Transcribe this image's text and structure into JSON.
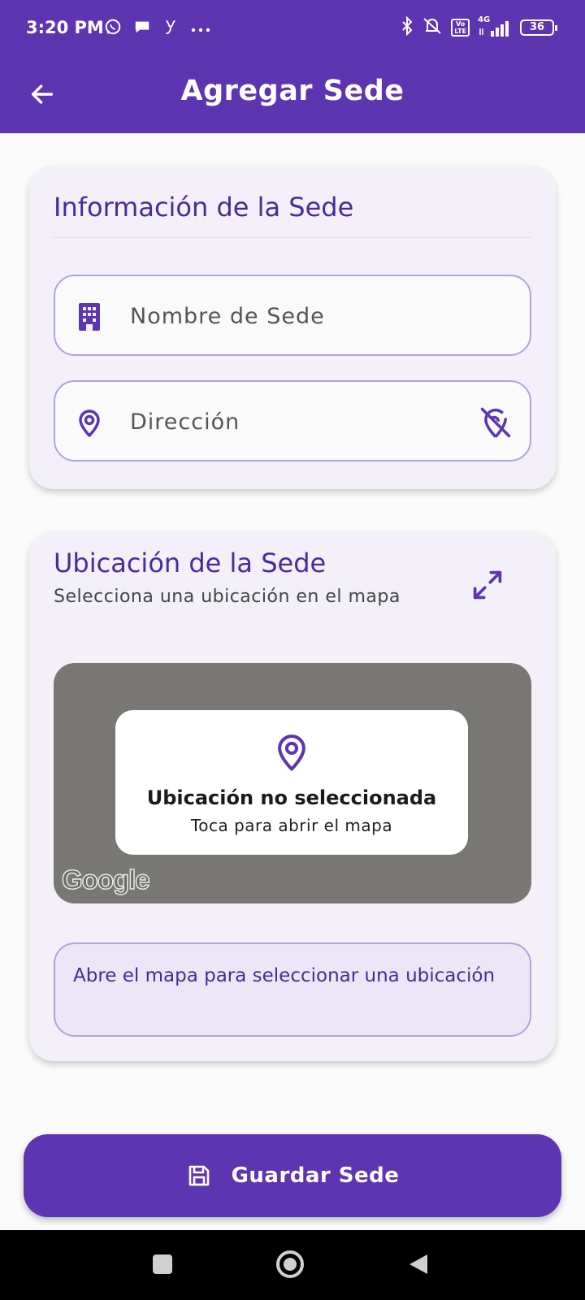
{
  "status_bar": {
    "time": "3:20 PM",
    "icons": [
      "whatsapp-icon",
      "chat-icon",
      "app-icon",
      "more-icon",
      "bluetooth-icon",
      "mute-icon",
      "volte-icon",
      "signal-icon",
      "battery-icon"
    ],
    "volte_top": "Vo",
    "volte_bottom": "LTE",
    "network": "4G",
    "battery": "36",
    "color": "#5e35b1"
  },
  "app_bar": {
    "title": "Agregar Sede",
    "back_icon": "arrow-left-icon"
  },
  "info_card": {
    "title": "Información de la Sede",
    "name_field": {
      "placeholder": "Nombre de Sede",
      "value": "",
      "icon": "building-icon"
    },
    "address_field": {
      "placeholder": "Dirección",
      "value": "",
      "icon": "location-pin-icon",
      "suffix_icon": "location-off-icon"
    }
  },
  "location_card": {
    "title": "Ubicación de la Sede",
    "subtitle": "Selecciona una ubicación en el mapa",
    "expand_icon": "expand-icon",
    "map": {
      "overlay_title": "Ubicación no seleccionada",
      "overlay_subtitle": "Toca para abrir el mapa",
      "logo": "Google"
    },
    "hint": "Abre el mapa para seleccionar una ubicación"
  },
  "save_button": {
    "label": "Guardar Sede",
    "icon": "save-icon"
  },
  "nav_bar": {
    "buttons": [
      "recent-apps-icon",
      "home-icon",
      "back-triangle-icon"
    ]
  },
  "colors": {
    "primary": "#5e35b1",
    "primary_dark_text": "#4a2a9a",
    "card_bg": "#f3f0f9",
    "map_bg": "#787774"
  }
}
